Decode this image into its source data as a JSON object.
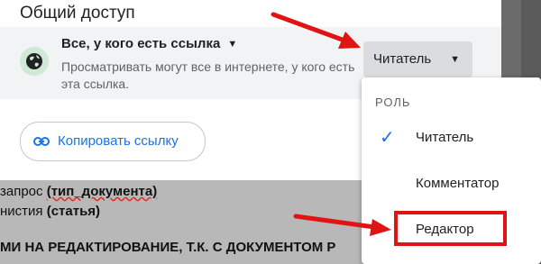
{
  "panel": {
    "title": "Общий доступ",
    "access_label": "Все, у кого есть ссылка",
    "access_description": "Просматривать могут все в интернете, у кого есть эта ссылка.",
    "role_button": "Читатель",
    "copy_link": "Копировать ссылку"
  },
  "menu": {
    "header": "РОЛЬ",
    "items": [
      {
        "label": "Читатель",
        "selected": true
      },
      {
        "label": "Комментатор",
        "selected": false
      },
      {
        "label": "Редактор",
        "selected": false
      }
    ]
  },
  "document": {
    "line1_prefix": "запрос ",
    "line1_bold": "(тип_документа)",
    "line2_prefix": "нистия ",
    "line2_bold": "(статья)",
    "line3": "МИ НА РЕДАКТИРОВАНИЕ, Т.К.  С ДОКУМЕНТОМ Р"
  },
  "colors": {
    "accent": "#1a73e8",
    "annotation_red": "#e11414",
    "globe_bg": "#ceead6"
  },
  "icons": {
    "globe": "globe-icon",
    "dropdown": "caret-down-icon",
    "link": "link-icon",
    "check": "check-icon"
  }
}
